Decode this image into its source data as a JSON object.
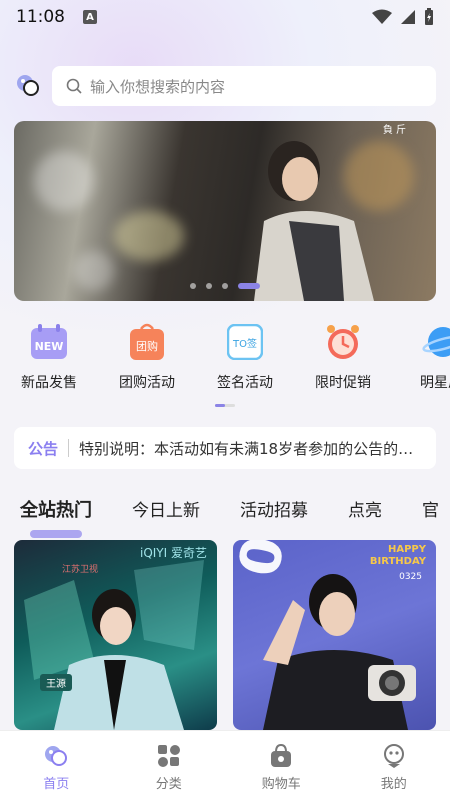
{
  "status": {
    "time": "11:08",
    "a_badge": "A"
  },
  "search": {
    "placeholder": "输入你想搜索的内容"
  },
  "banner": {
    "corner_text": "負 斤",
    "dots": 4,
    "active_dot": 3
  },
  "categories": [
    {
      "label": "新品发售",
      "icon": "new-icon",
      "badge": "NEW",
      "color": "#a79df5"
    },
    {
      "label": "团购活动",
      "icon": "group-buy-icon",
      "badge": "团购",
      "color": "#f6835a"
    },
    {
      "label": "签名活动",
      "icon": "signature-icon",
      "badge": "TO签",
      "color": "#6cc3f2"
    },
    {
      "label": "限时促销",
      "icon": "alarm-clock-icon",
      "badge": "",
      "color": "#f46a5a"
    },
    {
      "label": "明星周",
      "icon": "planet-icon",
      "badge": "",
      "color": "#3c9df5"
    }
  ],
  "notice": {
    "tag": "公告",
    "text": "特别说明：本活动如有未满18岁者参加的公告的…"
  },
  "tabs": [
    "全站热门",
    "今日上新",
    "活动招募",
    "点亮",
    "官"
  ],
  "cards": [
    {
      "top_text": "iQIYI 爱奇艺",
      "logo_text": "江苏卫视",
      "name_tag": "王源"
    },
    {
      "top_text": "HAPPY BIRTHDAY",
      "sub_text": "0325",
      "big_text": "0325"
    }
  ],
  "nav": [
    {
      "label": "首页",
      "icon": "home-icon",
      "active": true
    },
    {
      "label": "分类",
      "icon": "category-icon",
      "active": false
    },
    {
      "label": "购物车",
      "icon": "cart-icon",
      "active": false
    },
    {
      "label": "我的",
      "icon": "profile-icon",
      "active": false
    }
  ],
  "colors": {
    "accent": "#8b7ff0",
    "background": "#f4f3f8"
  }
}
